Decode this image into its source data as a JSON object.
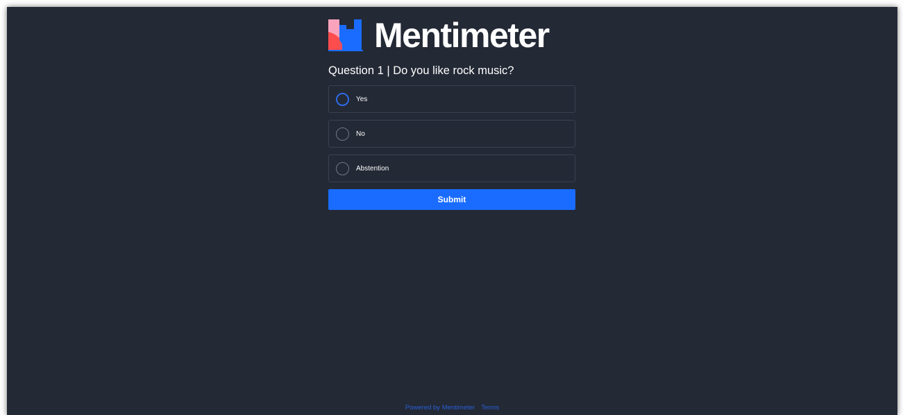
{
  "brand": {
    "name": "Mentimeter",
    "logo_icon": "mentimeter-logo-mark",
    "colors": {
      "pink": "#f9a3bd",
      "red": "#ff4e4e",
      "blue": "#196cff"
    }
  },
  "question": {
    "title": "Question 1 | Do you like rock music?"
  },
  "options": [
    {
      "label": "Yes",
      "focused": true
    },
    {
      "label": "No",
      "focused": false
    },
    {
      "label": "Abstention",
      "focused": false
    }
  ],
  "submit": {
    "label": "Submit",
    "color": "#196cff"
  },
  "footer": {
    "powered_by": "Powered by Mentimeter",
    "terms": "Terms"
  },
  "theme": {
    "background": "#232935",
    "accent": "#196cff"
  }
}
